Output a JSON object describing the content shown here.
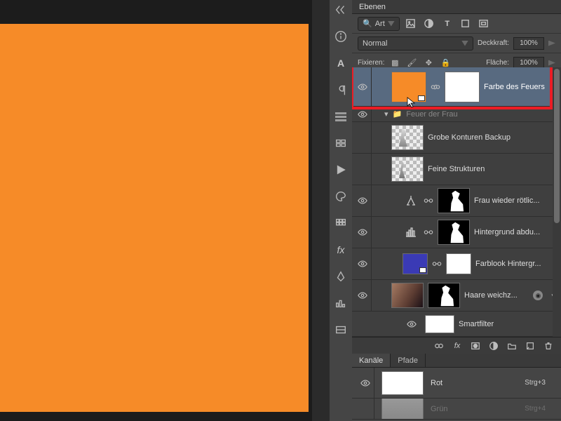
{
  "canvas": {
    "fill": "#f68b28"
  },
  "panel": {
    "tab_label": "Ebenen",
    "filter_label": "Art",
    "blend_mode": "Normal",
    "opacity_label": "Deckkraft:",
    "opacity_value": "100%",
    "lock_label": "Fixieren:",
    "fill_label": "Fläche:",
    "fill_value": "100%"
  },
  "layers": [
    {
      "name": "Farbe des Feuers",
      "selected": true,
      "highlight": true,
      "indent": 1,
      "thumbs": [
        "orange",
        "white"
      ],
      "link": true,
      "adj": null,
      "visible": true
    },
    {
      "name": "Feuer der Frau",
      "indent": 1,
      "group": true,
      "visible": true
    },
    {
      "name": "Grobe Konturen Backup",
      "indent": 1,
      "thumbs": [
        "checker-s"
      ],
      "visible": false
    },
    {
      "name": "Feine Strukturen",
      "indent": 1,
      "thumbs": [
        "checker-s"
      ],
      "visible": false
    },
    {
      "name": "Frau wieder rötlic...",
      "indent": 2,
      "adj": "balance",
      "thumbs": [
        "mask-sil"
      ],
      "link": true,
      "visible": true
    },
    {
      "name": "Hintergrund abdu...",
      "indent": 2,
      "adj": "levels",
      "thumbs": [
        "mask-sil"
      ],
      "link": true,
      "visible": true
    },
    {
      "name": "Farblook Hintergr...",
      "indent": 2,
      "thumbs": [
        "blue",
        "white"
      ],
      "link": true,
      "visible": true
    },
    {
      "name": "Haare weichz...",
      "indent": 1,
      "thumbs": [
        "photo",
        "mask-sil"
      ],
      "visible": true,
      "smart": true
    },
    {
      "name": "Smartfilter",
      "indent": 2,
      "thumbs": [
        "white-sm"
      ],
      "visible": true,
      "is_filter": true
    }
  ],
  "channels": {
    "tab1": "Kanäle",
    "tab2": "Pfade",
    "rows": [
      {
        "name": "Rot",
        "shortcut": "Strg+3",
        "thumb": "white"
      },
      {
        "name": "Grün",
        "shortcut": "Strg+4",
        "thumb": "gray"
      }
    ]
  }
}
